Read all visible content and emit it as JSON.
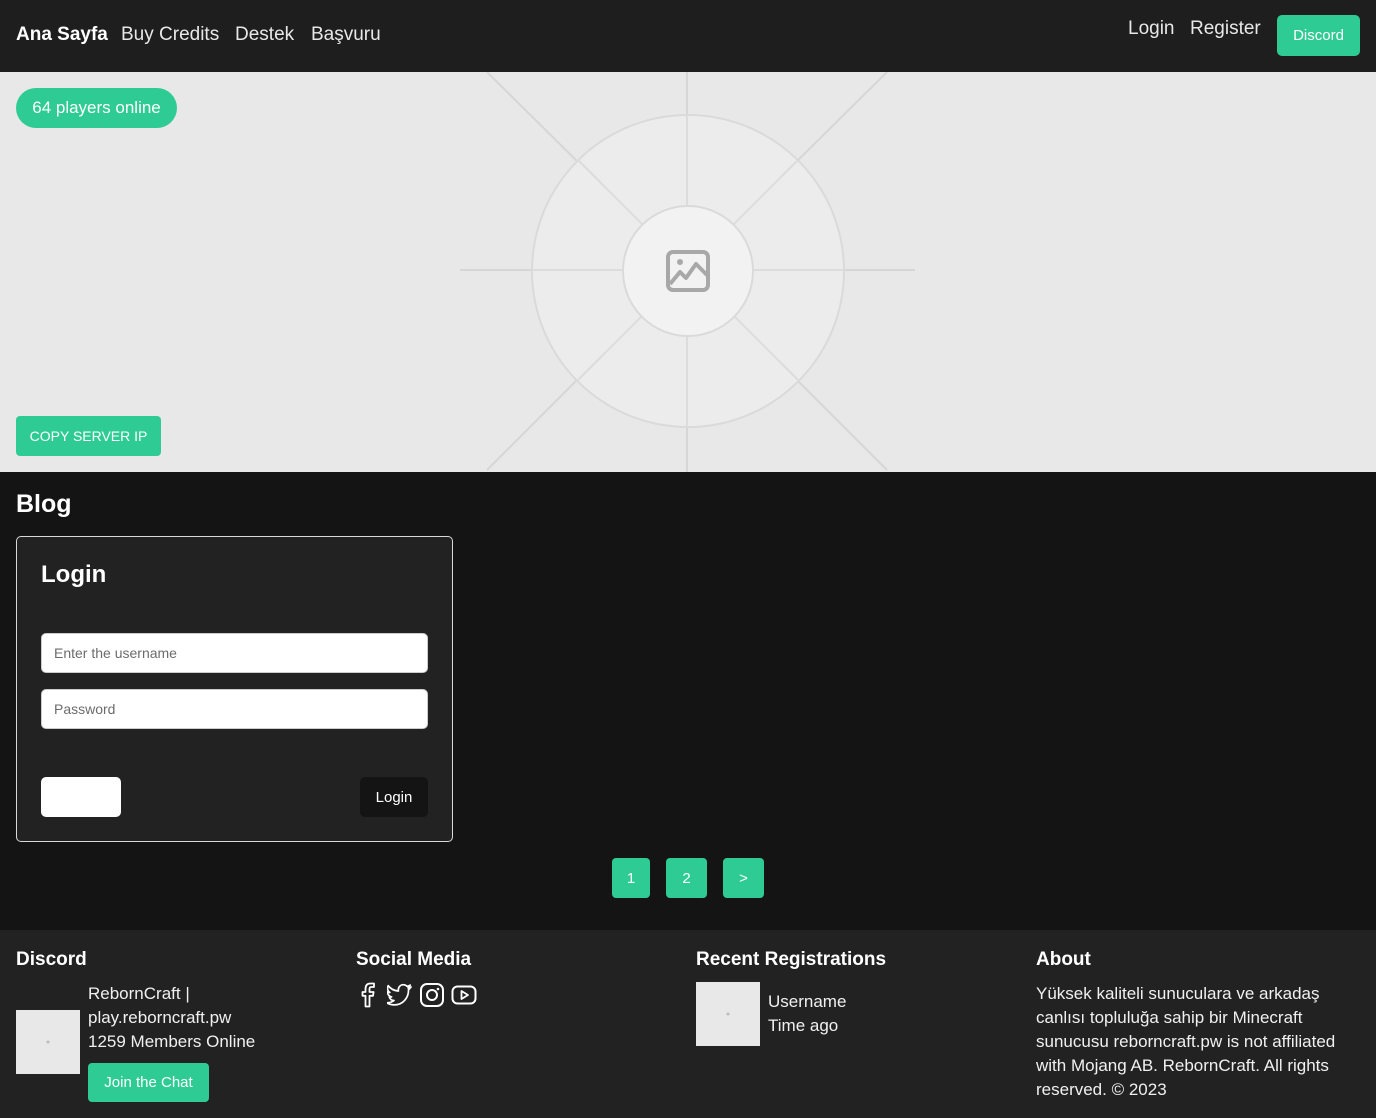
{
  "navbar": {
    "brand": "Ana Sayfa",
    "links": [
      "Buy Credits",
      "Destek",
      "Başvuru"
    ],
    "login": "Login",
    "register": "Register",
    "discord": "Discord"
  },
  "hero": {
    "online": "64 players online",
    "copy_ip": "COPY SERVER IP"
  },
  "blog": {
    "title": "Blog",
    "login_card": {
      "title": "Login",
      "username_placeholder": "Enter the username",
      "password_placeholder": "Password",
      "submit": "Login"
    }
  },
  "pagination": [
    "1",
    "2",
    ">"
  ],
  "footer": {
    "discord": {
      "title": "Discord",
      "server_line1": "RebornCraft |",
      "server_line2": "play.reborncraft.pw",
      "members": "1259 Members Online",
      "join": "Join the Chat"
    },
    "social": {
      "title": "Social Media",
      "icons": [
        "facebook-icon",
        "twitter-icon",
        "instagram-icon",
        "youtube-icon"
      ]
    },
    "recent": {
      "title": "Recent Registrations",
      "username": "Username",
      "time": "Time ago"
    },
    "about": {
      "title": "About",
      "text": "Yüksek kaliteli sunuculara ve arkadaş canlısı topluluğa sahip bir Minecraft sunucusu reborncraft.pw is not affiliated with Mojang AB. RebornCraft. All rights reserved. © 2023"
    }
  },
  "colors": {
    "accent": "#2ecc94",
    "nav_bg": "#1e1e1e",
    "page_bg": "#141414",
    "card_bg": "#222222",
    "hero_bg": "#e8e8e8"
  }
}
